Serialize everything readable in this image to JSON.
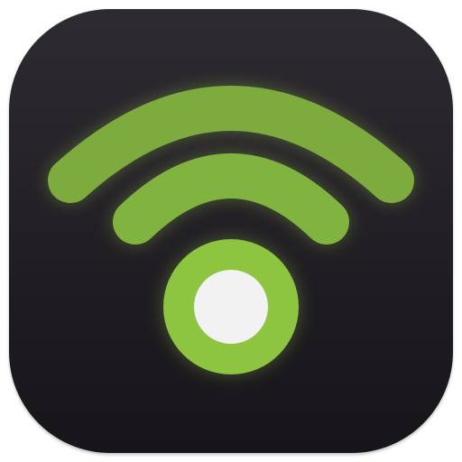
{
  "icon": {
    "name": "podcast-wifi-signal-icon",
    "colors": {
      "background_top": "#2e2a31",
      "background_bottom": "#171519",
      "arc_outer": "#7dab3c",
      "arc_inner": "#80b33f",
      "ring": "#8dc43f",
      "center_dot": "#f2f2f2",
      "glow": "#9bd14a"
    }
  }
}
